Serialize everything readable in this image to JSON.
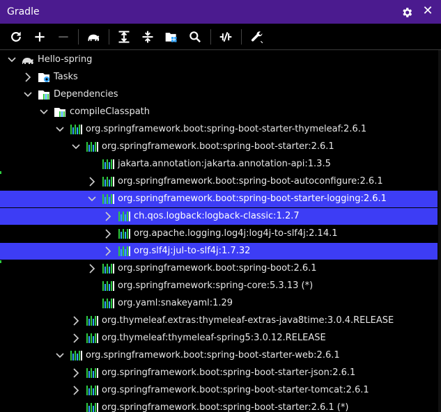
{
  "window": {
    "title": "Gradle"
  },
  "toolbar": {
    "buttons": [
      "refresh-icon",
      "add-icon",
      "remove-icon",
      "elephant-icon",
      "expand-all-icon",
      "collapse-all-icon",
      "group-modules-icon",
      "search-icon",
      "toggle-offline-icon",
      "settings-wrench-icon"
    ]
  },
  "tree": {
    "rows": [
      {
        "label": "Hello-spring",
        "depth": 0,
        "chevron": "down",
        "icon": "elephant",
        "selected": false
      },
      {
        "label": "Tasks",
        "depth": 1,
        "chevron": "right",
        "icon": "tasks",
        "selected": false
      },
      {
        "label": "Dependencies",
        "depth": 1,
        "chevron": "down",
        "icon": "deps",
        "selected": false
      },
      {
        "label": "compileClasspath",
        "depth": 2,
        "chevron": "down",
        "icon": "deps",
        "selected": false
      },
      {
        "label": "org.springframework.boot:spring-boot-starter-thymeleaf:2.6.1",
        "depth": 3,
        "chevron": "down",
        "icon": "lib",
        "selected": false
      },
      {
        "label": "org.springframework.boot:spring-boot-starter:2.6.1",
        "depth": 4,
        "chevron": "down",
        "icon": "lib",
        "selected": false
      },
      {
        "label": "jakarta.annotation:jakarta.annotation-api:1.3.5",
        "depth": 5,
        "chevron": "none",
        "icon": "lib",
        "selected": false
      },
      {
        "label": "org.springframework.boot:spring-boot-autoconfigure:2.6.1",
        "depth": 5,
        "chevron": "right",
        "icon": "lib",
        "selected": false
      },
      {
        "label": "org.springframework.boot:spring-boot-starter-logging:2.6.1",
        "depth": 5,
        "chevron": "down",
        "icon": "lib",
        "selected": true
      },
      {
        "label": "ch.qos.logback:logback-classic:1.2.7",
        "depth": 6,
        "chevron": "right",
        "icon": "lib",
        "selected": true
      },
      {
        "label": "org.apache.logging.log4j:log4j-to-slf4j:2.14.1",
        "depth": 6,
        "chevron": "right",
        "icon": "lib",
        "selected": false
      },
      {
        "label": "org.slf4j:jul-to-slf4j:1.7.32",
        "depth": 6,
        "chevron": "right",
        "icon": "lib",
        "selected": true
      },
      {
        "label": "org.springframework.boot:spring-boot:2.6.1",
        "depth": 5,
        "chevron": "right",
        "icon": "lib",
        "selected": false
      },
      {
        "label": "org.springframework:spring-core:5.3.13 (*)",
        "depth": 5,
        "chevron": "none",
        "icon": "lib",
        "selected": false
      },
      {
        "label": "org.yaml:snakeyaml:1.29",
        "depth": 5,
        "chevron": "none",
        "icon": "lib",
        "selected": false
      },
      {
        "label": "org.thymeleaf.extras:thymeleaf-extras-java8time:3.0.4.RELEASE",
        "depth": 4,
        "chevron": "right",
        "icon": "lib",
        "selected": false
      },
      {
        "label": "org.thymeleaf:thymeleaf-spring5:3.0.12.RELEASE",
        "depth": 4,
        "chevron": "right",
        "icon": "lib",
        "selected": false
      },
      {
        "label": "org.springframework.boot:spring-boot-starter-web:2.6.1",
        "depth": 3,
        "chevron": "down",
        "icon": "lib",
        "selected": false
      },
      {
        "label": "org.springframework.boot:spring-boot-starter-json:2.6.1",
        "depth": 4,
        "chevron": "right",
        "icon": "lib",
        "selected": false
      },
      {
        "label": "org.springframework.boot:spring-boot-starter-tomcat:2.6.1",
        "depth": 4,
        "chevron": "right",
        "icon": "lib",
        "selected": false
      },
      {
        "label": "org.springframework.boot:spring-boot-starter:2.6.1 (*)",
        "depth": 4,
        "chevron": "none",
        "icon": "lib",
        "selected": false
      }
    ]
  },
  "colors": {
    "titlebar": "#4b1b8f",
    "selection": "#3d3df5",
    "lib_green": "#2ecc40",
    "lib_blue": "#35a7ff"
  }
}
